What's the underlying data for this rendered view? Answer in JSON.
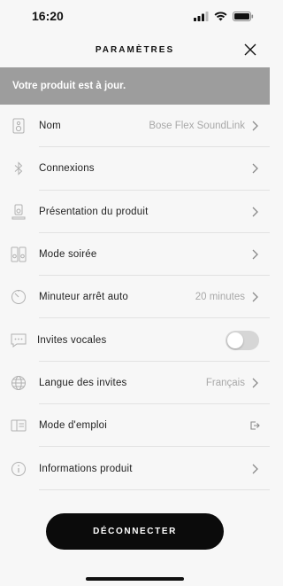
{
  "status_bar": {
    "time": "16:20"
  },
  "header": {
    "title": "PARAMÈTRES"
  },
  "banner": {
    "text": "Votre produit est à jour."
  },
  "settings": {
    "name": {
      "label": "Nom",
      "value": "Bose Flex SoundLink"
    },
    "connections": {
      "label": "Connexions"
    },
    "product_tour": {
      "label": "Présentation du produit"
    },
    "party_mode": {
      "label": "Mode soirée"
    },
    "auto_off": {
      "label": "Minuteur arrêt auto",
      "value": "20 minutes"
    },
    "voice_prompts": {
      "label": "Invites vocales",
      "enabled": false
    },
    "prompt_language": {
      "label": "Langue des invites",
      "value": "Français"
    },
    "manual": {
      "label": "Mode d'emploi"
    },
    "product_info": {
      "label": "Informations produit"
    }
  },
  "footer": {
    "disconnect_label": "DÉCONNECTER"
  }
}
